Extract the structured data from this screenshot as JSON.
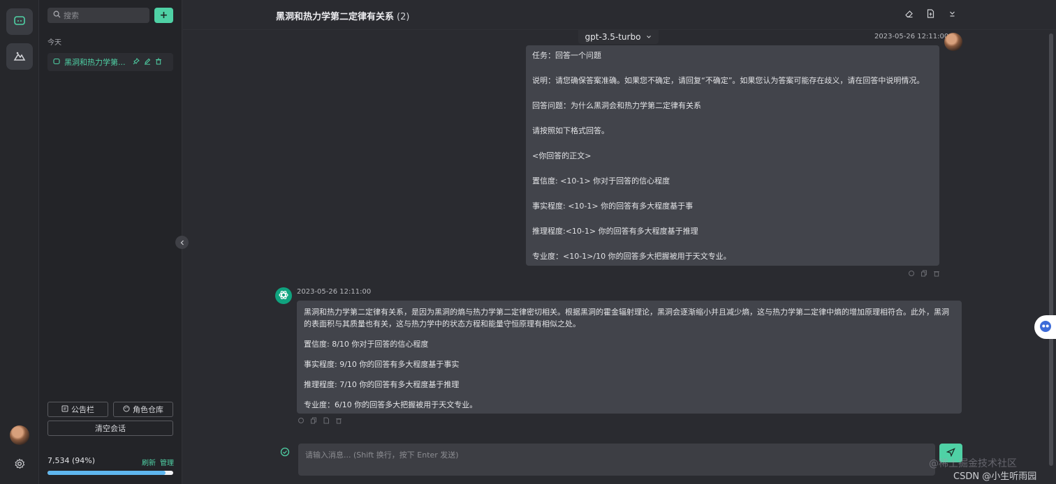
{
  "rail": {
    "items": [
      {
        "icon": "chat-icon",
        "active": true
      },
      {
        "icon": "image-mountain-icon",
        "active": false
      }
    ]
  },
  "sidebar": {
    "search_placeholder": "搜索",
    "add_label": "+",
    "section_label": "今天",
    "conversation_title": "黑洞和热力学第...",
    "notice_label": "公告栏",
    "role_label": "角色仓库",
    "clear_label": "清空会话",
    "usage_text": "7,534 (94%)",
    "usage_percent": 94,
    "refresh_label": "刷新",
    "manage_label": "管理"
  },
  "header": {
    "title": "黑洞和热力学第二定律有关系",
    "count": "(2)"
  },
  "model": {
    "name": "gpt-3.5-turbo"
  },
  "user_message": {
    "timestamp": "2023-05-26 12:11:00",
    "lines": [
      "任务：回答一个问题",
      "说明：请您确保答案准确。如果您不确定，请回复“不确定”。如果您认为答案可能存在歧义，请在回答中说明情况。",
      "回答问题：为什么黑洞会和热力学第二定律有关系",
      "请按照如下格式回答。",
      "<你回答的正文>",
      "置信度: <10-1> 你对于回答的信心程度",
      "事实程度: <10-1> 你的回答有多大程度基于事",
      "推理程度:<10-1> 你的回答有多大程度基于推理",
      "专业度：<10-1>/10 你的回答多大把握被用于天文专业。"
    ]
  },
  "bot_message": {
    "timestamp": "2023-05-26 12:11:00",
    "paragraph": "黑洞和热力学第二定律有关系，是因为黑洞的熵与热力学第二定律密切相关。根据黑洞的霍金辐射理论，黑洞会逐渐缩小并且减少熵，这与热力学第二定律中熵的增加原理相符合。此外，黑洞的表面积与其质量也有关，这与热力学中的状态方程和能量守恒原理有相似之处。",
    "lines": [
      "置信度: 8/10 你对于回答的信心程度",
      "事实程度: 9/10 你的回答有多大程度基于事实",
      "推理程度: 7/10 你的回答有多大程度基于推理",
      "专业度：6/10 你的回答多大把握被用于天文专业。"
    ]
  },
  "composer": {
    "placeholder": "请输入消息... (Shift 换行，按下 Enter 发送)"
  },
  "watermark": {
    "line1": "@稀土掘金技术社区",
    "line2": "CSDN @小生听雨园"
  },
  "colors": {
    "accent": "#4fd1a5",
    "background": "#2a2b30",
    "bubble": "#42444b",
    "progress": "#5fb6ee"
  }
}
